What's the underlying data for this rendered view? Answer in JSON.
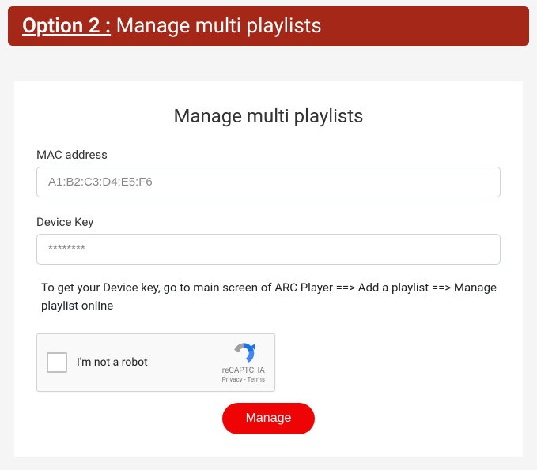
{
  "header": {
    "prefix": "Option 2 :",
    "suffix": " Manage multi playlists"
  },
  "card": {
    "title": "Manage multi playlists",
    "mac_label": "MAC address",
    "mac_placeholder": "A1:B2:C3:D4:E5:F6",
    "devicekey_label": "Device Key",
    "devicekey_placeholder": "********",
    "help_text": "To get your Device key, go to main screen of ARC Player ==> Add a playlist ==> Manage playlist online",
    "recaptcha": {
      "label": "I'm not a robot",
      "brand": "reCAPTCHA",
      "links": "Privacy - Terms"
    },
    "manage_button": "Manage"
  }
}
